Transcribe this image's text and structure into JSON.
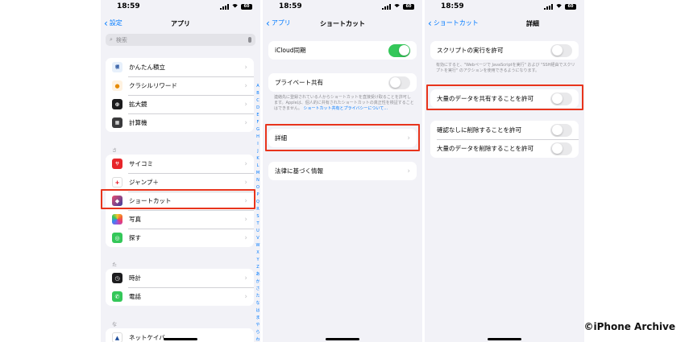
{
  "colors": {
    "accent": "#007aff",
    "toggle_on": "#34c759",
    "highlight": "#e8341c",
    "background": "#f2f2f7"
  },
  "screen1": {
    "time": "18:59",
    "battery": "60",
    "back_label": "設定",
    "title": "アプリ",
    "search_placeholder": "検索",
    "apps_a": [
      {
        "label": "かんたん積立",
        "icon": "kantan-tsumitate-icon",
        "color": "#e7f0fb"
      },
      {
        "label": "クラシルリワード",
        "icon": "kurashiru-reward-icon",
        "color": "#fff2e0"
      },
      {
        "label": "拡大鏡",
        "icon": "magnifier-icon",
        "color": "#1c1c1e"
      },
      {
        "label": "計算機",
        "icon": "calculator-icon",
        "color": "#3a3a3c"
      }
    ],
    "section_sa": "さ",
    "apps_sa": [
      {
        "label": "サイコミ",
        "icon": "saikomi-icon",
        "color": "#e7262b"
      },
      {
        "label": "ジャンプ＋",
        "icon": "jump-plus-icon",
        "color": "#ffffff"
      },
      {
        "label": "ショートカット",
        "icon": "shortcuts-icon",
        "color": "#3b3f9e"
      },
      {
        "label": "写真",
        "icon": "photos-icon",
        "color": "#ffffff"
      },
      {
        "label": "探す",
        "icon": "find-my-icon",
        "color": "#34c759"
      }
    ],
    "section_ta": "た",
    "apps_ta": [
      {
        "label": "時計",
        "icon": "clock-icon",
        "color": "#1c1c1e"
      },
      {
        "label": "電話",
        "icon": "phone-icon",
        "color": "#34c759"
      }
    ],
    "section_na": "な",
    "apps_na": [
      {
        "label": "ネットケイバ",
        "icon": "netkeiba-icon",
        "color": "#ffffff"
      }
    ],
    "index_letters": [
      "A",
      "B",
      "C",
      "D",
      "E",
      "F",
      "G",
      "H",
      "I",
      "J",
      "K",
      "L",
      "M",
      "N",
      "O",
      "P",
      "Q",
      "R",
      "S",
      "T",
      "U",
      "V",
      "W",
      "X",
      "Y",
      "Z",
      "あ",
      "か",
      "さ",
      "た",
      "な",
      "は",
      "ま",
      "や",
      "ら",
      "わ",
      "#"
    ]
  },
  "screen2": {
    "time": "18:59",
    "battery": "60",
    "back_label": "アプリ",
    "title": "ショートカット",
    "icloud_label": "iCloud同期",
    "icloud_on": true,
    "private_label": "プライベート共有",
    "private_on": false,
    "private_note": "連絡先に登録されている人からショートカットを直接受け取ることを許可します。Appleは、個人的に共有されたショートカットの真正性を検証することはできません。",
    "private_note_link": "ショートカット共有とプライバシーについて…",
    "details_label": "詳細",
    "legal_label": "法律に基づく情報"
  },
  "screen3": {
    "time": "18:59",
    "battery": "60",
    "back_label": "ショートカット",
    "title": "詳細",
    "script_label": "スクリプトの実行を許可",
    "script_note": "有効にすると、\"Webページで JavaScriptを実行\" および \"SSH経由でスクリプトを実行\" のアクションを使用できるようになります。",
    "share_label": "大量のデータを共有することを許可",
    "delete_confirm_label": "確認なしに削除することを許可",
    "delete_bulk_label": "大量のデータを削除することを許可"
  },
  "watermark": "©iPhone Archive"
}
